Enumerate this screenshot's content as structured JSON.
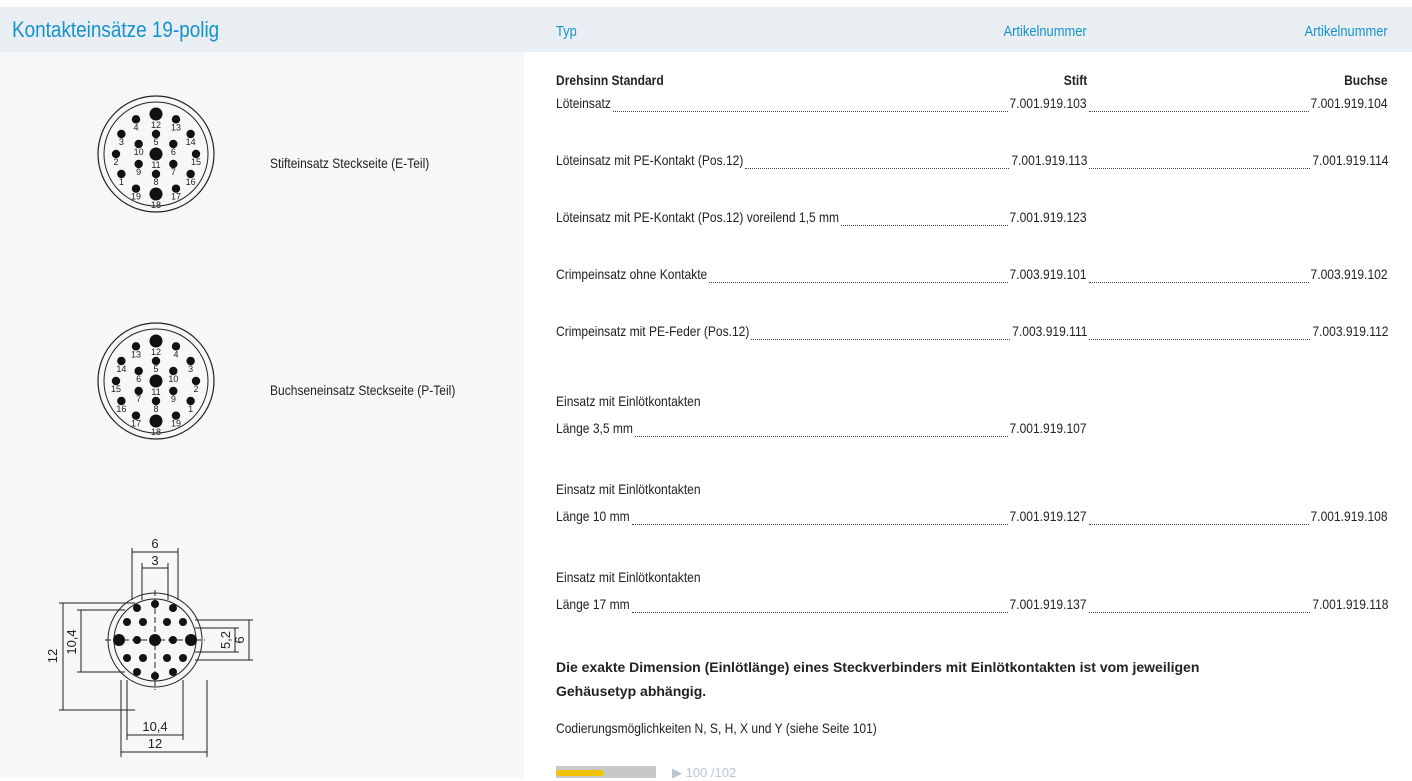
{
  "header": {
    "title": "Kontakteinsätze 19-polig",
    "col_typ": "Typ",
    "col_stift": "Artikelnummer",
    "col_buchse": "Artikelnummer"
  },
  "images": {
    "pin_insert_label": "Stifteinsatz Steckseite (E-Teil)",
    "socket_insert_label": "Buchseneinsatz Steckseite (P-Teil)",
    "pin_numbers_e": [
      "1",
      "2",
      "3",
      "4",
      "5",
      "6",
      "7",
      "8",
      "9",
      "10",
      "11",
      "12",
      "13",
      "14",
      "15",
      "16",
      "17",
      "18",
      "19"
    ],
    "dimension_labels": [
      "6",
      "3",
      "12",
      "10,4",
      "5,2",
      "6",
      "10,4",
      "12"
    ]
  },
  "table": {
    "section_label": "Drehsinn Standard",
    "stift_header": "Stift",
    "buchse_header": "Buchse",
    "rows": [
      {
        "text": "Löteinsatz",
        "stift": "7.001.919.103",
        "buchse": "7.001.919.104"
      },
      {
        "text": "Löteinsatz mit PE-Kontakt (Pos.12)",
        "stift": "7.001.919.113",
        "buchse": "7.001.919.114"
      },
      {
        "text": "Löteinsatz mit PE-Kontakt (Pos.12) voreilend 1,5 mm",
        "stift": "7.001.919.123",
        "buchse": ""
      },
      {
        "text": "Crimpeinsatz ohne Kontakte",
        "stift": "7.003.919.101",
        "buchse": "7.003.919.102"
      },
      {
        "text": "Crimpeinsatz mit PE-Feder (Pos.12)",
        "stift": "7.003.919.111",
        "buchse": "7.003.919.112"
      },
      {
        "heading": "Einsatz mit Einlötkontakten",
        "text": "Länge 3,5 mm",
        "stift": "7.001.919.107",
        "buchse": ""
      },
      {
        "heading": "Einsatz mit Einlötkontakten",
        "text": "Länge 10 mm",
        "stift": "7.001.919.127",
        "buchse": "7.001.919.108"
      },
      {
        "heading": "Einsatz mit Einlötkontakten",
        "text": "Länge 17 mm",
        "stift": "7.001.919.137",
        "buchse": "7.001.919.118"
      }
    ]
  },
  "note": "Die exakte Dimension (Einlötlänge) eines Steckverbinders mit Einlötkontakten ist vom jeweiligen Gehäusetyp abhängig.",
  "codierung": "Codierungsmöglichkeiten N, S, H, X und Y (siehe Seite 101)",
  "page_ref": "▶ 100 /102"
}
